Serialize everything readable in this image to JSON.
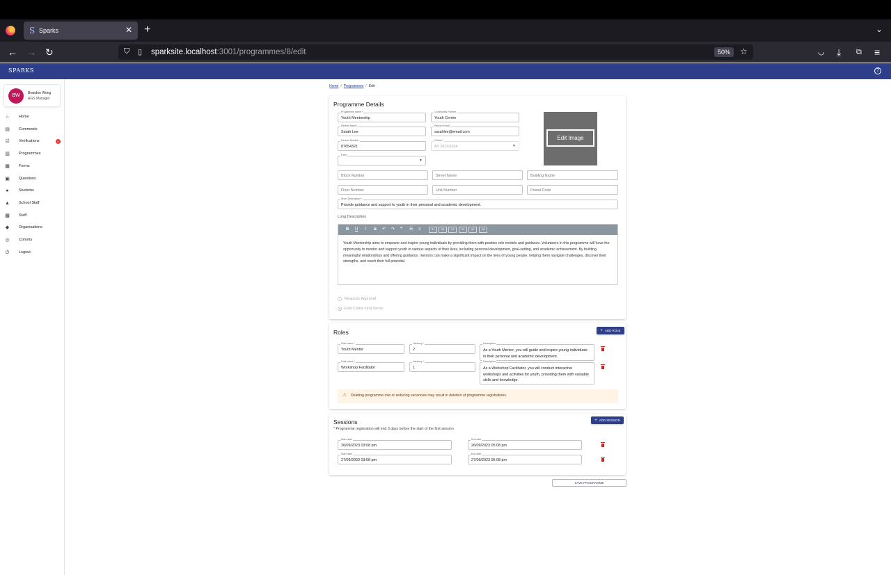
{
  "browser": {
    "tab_title": "Sparks",
    "tab_favicon": "S",
    "url_host": "sparksite.localhost",
    "url_path": ":3001/programmes/8/edit",
    "zoom": "50%"
  },
  "app": {
    "brand": "SPARKS",
    "user": {
      "initials": "BW",
      "name": "Brandon Wong",
      "role": "AGS Manager"
    },
    "nav": [
      {
        "label": "Home",
        "icon": "home-icon"
      },
      {
        "label": "Comments",
        "icon": "comment-icon"
      },
      {
        "label": "Verifications",
        "icon": "checkbox-icon",
        "badge": "2"
      },
      {
        "label": "Programmes",
        "icon": "document-icon"
      },
      {
        "label": "Forms",
        "icon": "form-icon"
      },
      {
        "label": "Questions",
        "icon": "questions-icon"
      },
      {
        "label": "Students",
        "icon": "person-icon"
      },
      {
        "label": "School Staff",
        "icon": "school-icon"
      },
      {
        "label": "Staff",
        "icon": "badge-icon"
      },
      {
        "label": "Organisations",
        "icon": "organisation-icon"
      },
      {
        "label": "Cohorts",
        "icon": "cohort-icon"
      },
      {
        "label": "Logout",
        "icon": "power-icon"
      }
    ]
  },
  "breadcrumb": {
    "home": "Home",
    "programmes": "Programmes",
    "current": "Edit"
  },
  "details": {
    "title": "Programme Details",
    "programme_name": {
      "label": "Programme name *",
      "value": "Youth Mentorship"
    },
    "community_partner": {
      "label": "Community Partner",
      "value": "Youth Centre"
    },
    "partner_name": {
      "label": "Partner Name",
      "value": "Sarah Lee"
    },
    "partner_email": {
      "label": "Partner Email",
      "value": "sarahlee@email.com"
    },
    "partner_number": {
      "label": "Partner Number",
      "value": "87654321"
    },
    "cohort": {
      "label": "Cohort *",
      "value": "AY 2023/2024"
    },
    "form": {
      "label": "Form",
      "value": ""
    },
    "edit_image": "Edit Image",
    "block_number": "Block Number",
    "street_name": "Street Name",
    "building_name": "Building Name",
    "floor_number": "Floor Number",
    "unit_number": "Unit Number",
    "postal_code": "Postal Code",
    "short_description": {
      "label": "Short Description *",
      "value": "Provide guidance and support to youth in their personal and academic development."
    },
    "long_description_label": "Long Description",
    "toolbar": {
      "bold": "B",
      "underline": "U",
      "italic": "I",
      "strike": "S",
      "undo": "↶",
      "redo": "↷",
      "quote": "❞",
      "bullets": "☰",
      "numbered": "≡",
      "h1": "H1",
      "h2": "H2",
      "h3": "H3",
      "h4": "H4",
      "h5": "H5",
      "h6": "H6"
    },
    "long_description": "Youth Mentorship aims to empower and inspire young individuals by providing them with positive role models and guidance. Volunteers in this programme will have the opportunity to mentor and support youth in various aspects of their lives, including personal development, goal-setting, and academic achievement. By building meaningful relationships and offering guidance, mentors can make a significant impact on the lives of young people, helping them navigate challenges, discover their strengths, and reach their full potential.",
    "radio_requires_approval": "Requires Approval",
    "radio_first_come": "First Come First Serve"
  },
  "roles": {
    "title": "Roles",
    "add_label": "ADD ROLE",
    "name_label": "Role name *",
    "vacancy_label": "Vacancy *",
    "desc_label": "Description",
    "items": [
      {
        "name": "Youth Mentor",
        "vacancy": "2",
        "description": "As a Youth Mentor, you will guide and inspire young individuals in their personal and academic development."
      },
      {
        "name": "Workshop Facilitator",
        "vacancy": "1",
        "description": "As a Workshop Facilitator, you will conduct interactive workshops and activities for youth, providing them with valuable skills and knowledge."
      }
    ],
    "warning": "Deleting programme role or reducing vacancies may result in deletion of programme registrations."
  },
  "sessions": {
    "title": "Sessions",
    "add_label": "ADD SESSION",
    "note": "* Programme registration will end 3 days before the start of the first session",
    "start_label": "Start date",
    "end_label": "End date",
    "items": [
      {
        "start": "26/09/2023 03:08 pm",
        "end": "26/09/2023 05:08 pm"
      },
      {
        "start": "27/09/2023 03:08 pm",
        "end": "27/09/2023 05:08 pm"
      }
    ]
  },
  "save_label": "SAVE PROGRAMME"
}
